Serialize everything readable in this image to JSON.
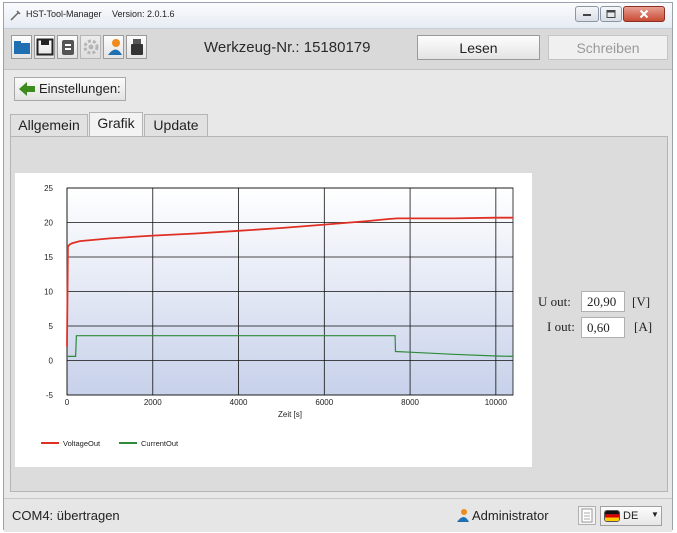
{
  "window": {
    "title": "HST-Tool-Manager",
    "version": "Version: 2.0.1.6"
  },
  "toolbar": {
    "tool_number": "Werkzeug-Nr.: 15180179",
    "read_label": "Lesen",
    "write_label": "Schreiben",
    "icons": [
      "folder-open-icon",
      "save-icon",
      "list-icon",
      "gear-icon",
      "user-icon",
      "usb-stick-icon"
    ]
  },
  "settings_button": {
    "label": "Einstellungen:"
  },
  "tabs": [
    {
      "label": "Allgemein",
      "active": false
    },
    {
      "label": "Grafik",
      "active": true
    },
    {
      "label": "Update",
      "active": false
    }
  ],
  "readouts": {
    "u_label": "U out:",
    "u_value": "20,90",
    "u_unit": "[V]",
    "i_label": "I out:",
    "i_value": "0,60",
    "i_unit": "[A]"
  },
  "status": {
    "text": "COM4: übertragen",
    "user": "Administrator",
    "language": "DE"
  },
  "colors": {
    "voltage": "#e03024",
    "current": "#2e8b3a",
    "plot_top": "#ffffff",
    "plot_bottom": "#c7d1ea"
  },
  "chart_data": {
    "type": "line",
    "xlabel": "Zeit [s]",
    "ylabel": "",
    "xlim": [
      0,
      10400
    ],
    "ylim": [
      -5,
      25
    ],
    "xticks": [
      0,
      2000,
      4000,
      6000,
      8000,
      10000
    ],
    "yticks": [
      -5,
      0,
      5,
      10,
      15,
      20,
      25
    ],
    "grid": true,
    "legend": "bottom-left",
    "series": [
      {
        "name": "VoltageOut",
        "color": "#e03024",
        "x": [
          0,
          20,
          60,
          120,
          300,
          1000,
          2000,
          3000,
          4000,
          5000,
          6000,
          7000,
          7500,
          7700,
          8000,
          9000,
          10000,
          10400
        ],
        "y": [
          2,
          16.5,
          16.8,
          17.0,
          17.3,
          17.7,
          18.1,
          18.4,
          18.8,
          19.2,
          19.7,
          20.2,
          20.5,
          20.6,
          20.6,
          20.6,
          20.7,
          20.7
        ]
      },
      {
        "name": "CurrentOut",
        "color": "#2e8b3a",
        "x": [
          0,
          200,
          220,
          1000,
          2000,
          3000,
          4000,
          5000,
          6000,
          7000,
          7650,
          7660,
          8000,
          9000,
          10000,
          10400
        ],
        "y": [
          0.6,
          0.6,
          3.6,
          3.6,
          3.6,
          3.6,
          3.6,
          3.6,
          3.6,
          3.6,
          3.6,
          1.3,
          1.2,
          0.9,
          0.65,
          0.6
        ]
      }
    ]
  }
}
